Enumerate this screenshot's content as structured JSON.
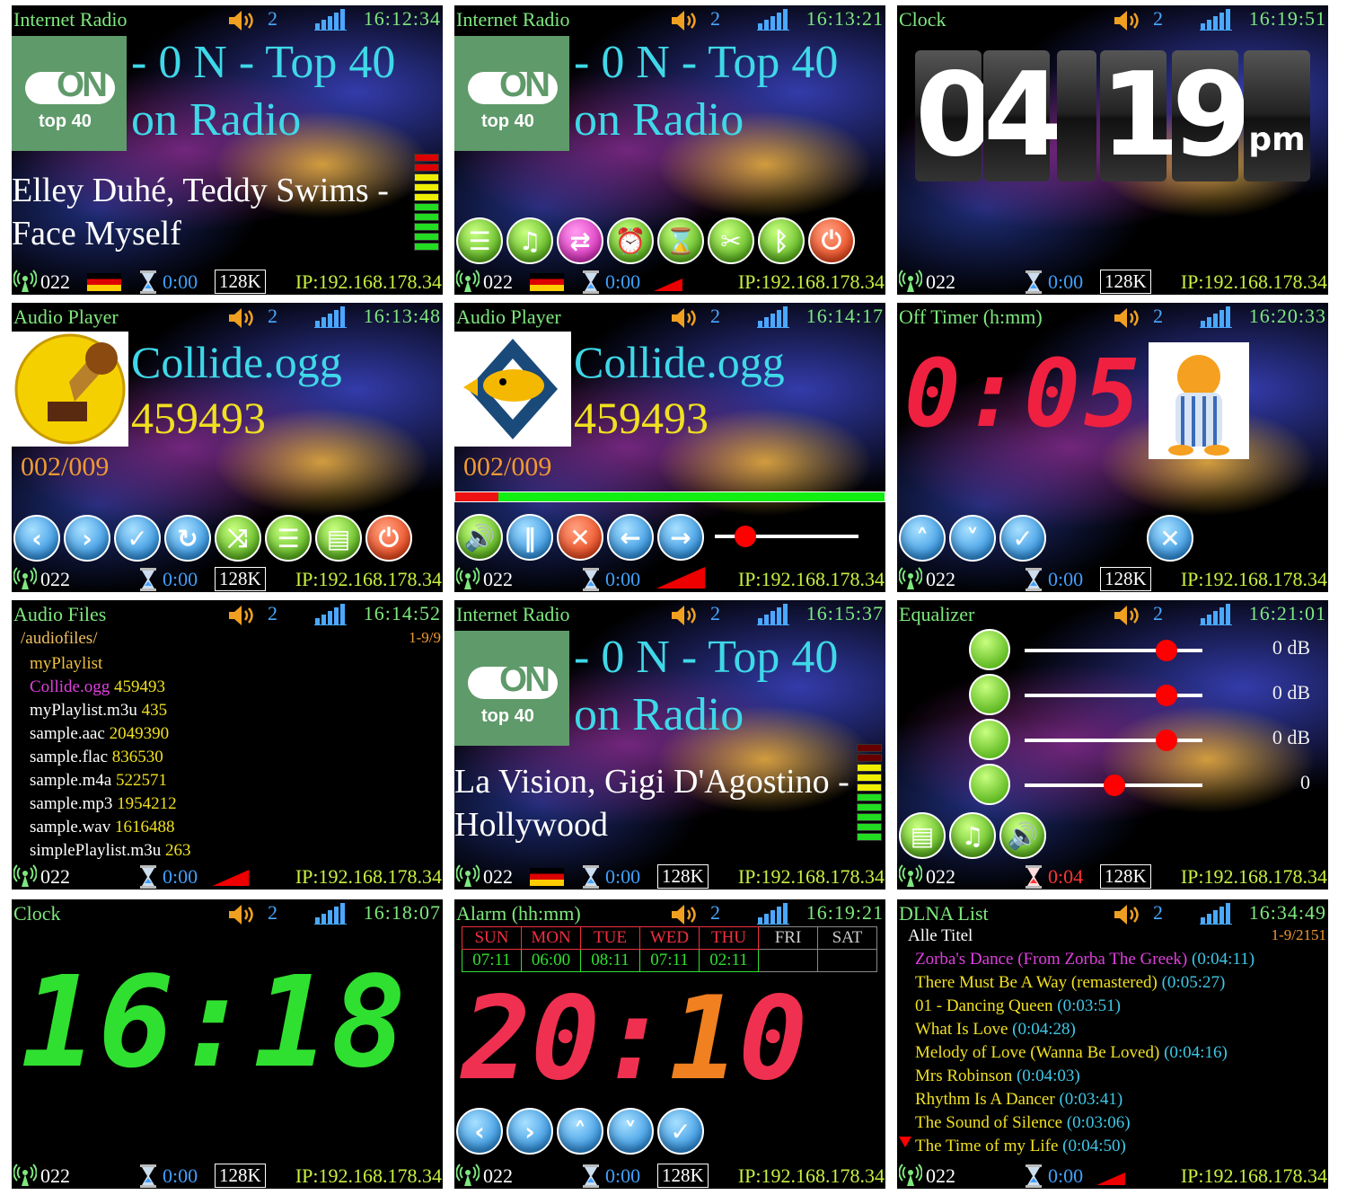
{
  "common": {
    "vol": "2",
    "station_num": "022",
    "ip": "IP:192.168.178.34",
    "bitrate": "128K",
    "timer": "0:00"
  },
  "p1": {
    "title": "Internet Radio",
    "time": "16:12:34",
    "logo_on": "ON",
    "logo_sub": "top 40",
    "station1": "- 0 N - Top 40",
    "station2": "on Radio",
    "song": "Elley Duhé, Teddy Swims - Face Myself"
  },
  "p2": {
    "title": "Internet Radio",
    "time": "16:13:21",
    "logo_on": "ON",
    "logo_sub": "top 40",
    "station1": "- 0 N - Top 40",
    "station2": "on Radio"
  },
  "p3": {
    "title": "Clock",
    "time": "16:19:51",
    "digits": [
      "0",
      "4",
      "1",
      "9"
    ],
    "ampm": "pm"
  },
  "p4": {
    "title": "Audio Player",
    "time": "16:13:48",
    "file": "Collide.ogg",
    "size": "459493",
    "count": "002/009"
  },
  "p5": {
    "title": "Audio Player",
    "time": "16:14:17",
    "file": "Collide.ogg",
    "size": "459493",
    "count": "002/009",
    "progress": 0.1
  },
  "p6": {
    "title": "Off Timer (h:mm)",
    "time": "16:20:33",
    "value": "0:05"
  },
  "p7": {
    "title": "Audio Files",
    "time": "16:14:52",
    "path": "/audiofiles/",
    "range": "1-9/9",
    "items": [
      [
        "myPlaylist",
        ""
      ],
      [
        "Collide.ogg",
        "459493"
      ],
      [
        "myPlaylist.m3u",
        "435"
      ],
      [
        "sample.aac",
        "2049390"
      ],
      [
        "sample.flac",
        "836530"
      ],
      [
        "sample.m4a",
        "522571"
      ],
      [
        "sample.mp3",
        "1954212"
      ],
      [
        "sample.wav",
        "1616488"
      ],
      [
        "simplePlaylist.m3u",
        "263"
      ]
    ]
  },
  "p8": {
    "title": "Internet Radio",
    "time": "16:15:37",
    "logo_on": "ON",
    "logo_sub": "top 40",
    "station1": "- 0 N - Top 40",
    "station2": "on Radio",
    "song": "La Vision, Gigi D'Agostino - Hollywood"
  },
  "p9": {
    "title": "Equalizer",
    "time": "16:21:01",
    "bands": [
      {
        "val": "0 dB",
        "pos": 0.8
      },
      {
        "val": "0 dB",
        "pos": 0.8
      },
      {
        "val": "0 dB",
        "pos": 0.8
      },
      {
        "val": "0",
        "pos": 0.5
      }
    ],
    "timer": "0:04"
  },
  "p10": {
    "title": "Clock",
    "time": "16:18:07",
    "display": "16:18"
  },
  "p11": {
    "title": "Alarm (hh:mm)",
    "time": "16:19:21",
    "days": [
      "SUN",
      "MON",
      "TUE",
      "WED",
      "THU",
      "FRI",
      "SAT"
    ],
    "alarms": [
      "07:11",
      "06:00",
      "08:11",
      "07:11",
      "02:11",
      "",
      ""
    ],
    "h": "20",
    "m1": "1",
    "m2": "0"
  },
  "p12": {
    "title": "DLNA List",
    "time": "16:34:49",
    "folder": "Alle Titel",
    "range": "1-9/2151",
    "tracks": [
      [
        "Zorba's Dance (From Zorba The Greek)",
        "(0:04:11)"
      ],
      [
        "There Must Be A Way (remastered)",
        "(0:05:27)"
      ],
      [
        "01 - Dancing Queen",
        "(0:03:51)"
      ],
      [
        "What Is Love",
        "(0:04:28)"
      ],
      [
        "Melody of Love (Wanna Be Loved)",
        "(0:04:16)"
      ],
      [
        "Mrs Robinson",
        "(0:04:03)"
      ],
      [
        "Rhythm Is A Dancer",
        "(0:03:41)"
      ],
      [
        "The Sound of Silence",
        "(0:03:06)"
      ],
      [
        "The Time of my Life",
        "(0:04:50)"
      ]
    ]
  }
}
